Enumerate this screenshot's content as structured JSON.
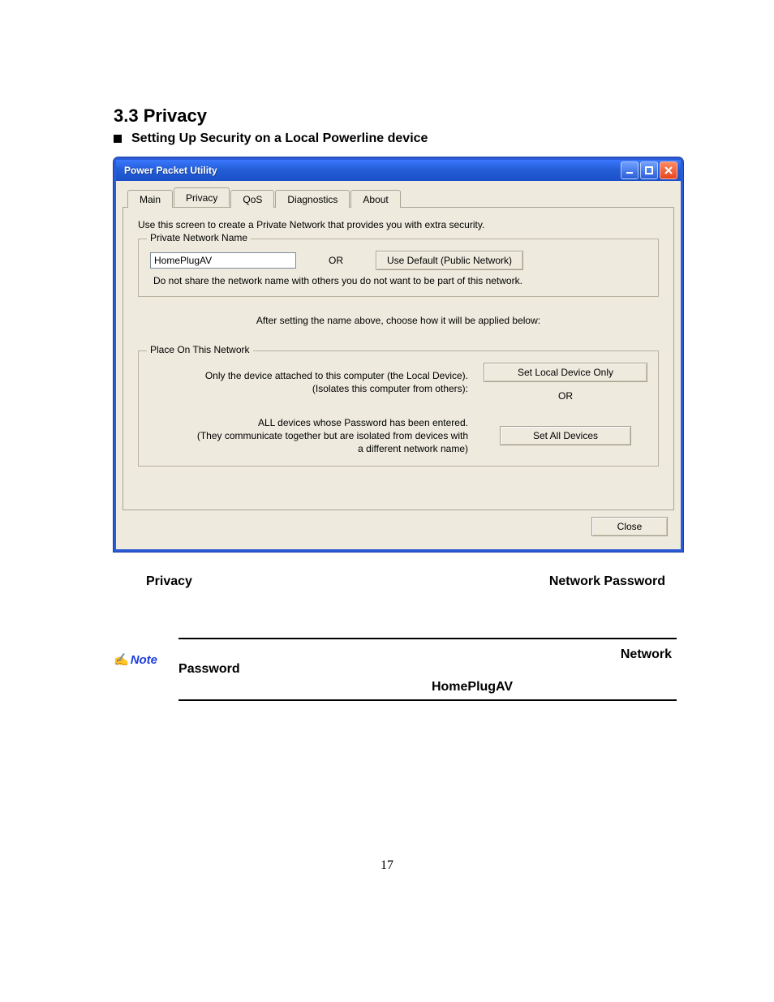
{
  "doc": {
    "section_title": "3.3 Privacy",
    "bullet_heading": "Setting Up Security on a Local Powerline device",
    "below": {
      "left": "Privacy",
      "right": "Network Password"
    },
    "note": {
      "label": "Note",
      "row1": "Network",
      "row2": "Password",
      "row3": "HomePlugAV"
    },
    "page_number": "17"
  },
  "window": {
    "title": "Power Packet Utility",
    "tabs": {
      "main": "Main",
      "privacy": "Privacy",
      "qos": "QoS",
      "diagnostics": "Diagnostics",
      "about": "About"
    },
    "intro": "Use this screen to create a Private Network that provides you with extra security.",
    "private_network": {
      "legend": "Private Network Name",
      "value": "HomePlugAV",
      "or": "OR",
      "use_default_btn": "Use Default (Public Network)",
      "no_share": "Do not share the network name with others you do not want to be part of this network."
    },
    "after_setting": "After setting the name above, choose how it will be applied below:",
    "place": {
      "legend": "Place On This Network",
      "local_only_text_l1": "Only the device attached to this computer (the Local Device).",
      "local_only_text_l2": "(Isolates this computer from others):",
      "set_local_btn": "Set Local Device Only",
      "or": "OR",
      "all_text_l1": "ALL devices whose Password has been entered.",
      "all_text_l2": "(They communicate together but are isolated from devices with",
      "all_text_l3": "a different network name)",
      "set_all_btn": "Set All Devices"
    },
    "close_btn": "Close"
  }
}
